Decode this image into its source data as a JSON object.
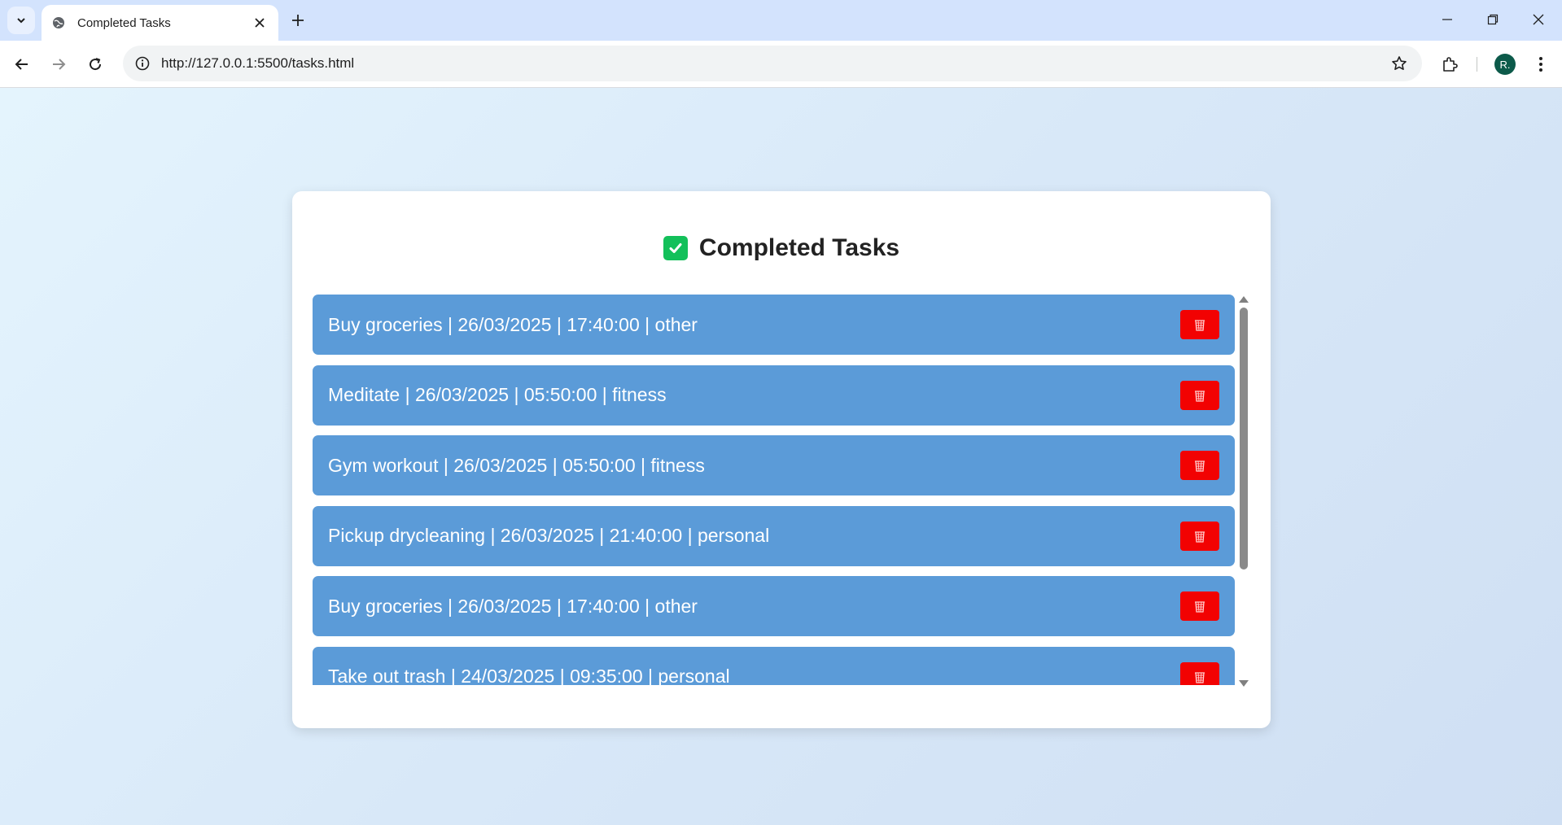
{
  "browser": {
    "tab_title": "Completed Tasks",
    "url": "http://127.0.0.1:5500/tasks.html",
    "profile_initial": "R."
  },
  "page": {
    "title": "Completed Tasks",
    "tasks": [
      {
        "text": "Buy groceries | 26/03/2025 | 17:40:00 | other"
      },
      {
        "text": "Meditate | 26/03/2025 | 05:50:00 | fitness"
      },
      {
        "text": "Gym workout | 26/03/2025 | 05:50:00 | fitness"
      },
      {
        "text": "Pickup drycleaning | 26/03/2025 | 21:40:00 | personal"
      },
      {
        "text": "Buy groceries | 26/03/2025 | 17:40:00 | other"
      },
      {
        "text": "Take out trash | 24/03/2025 | 09:35:00 | personal"
      }
    ]
  },
  "colors": {
    "task_bg": "#5b9bd8",
    "delete_bg": "#f20202",
    "check_bg": "#13c05a"
  },
  "icons": {
    "tab_search": "chevron-down-icon",
    "favicon": "globe-icon",
    "check": "checkbox-checked-icon",
    "delete": "trash-icon"
  }
}
